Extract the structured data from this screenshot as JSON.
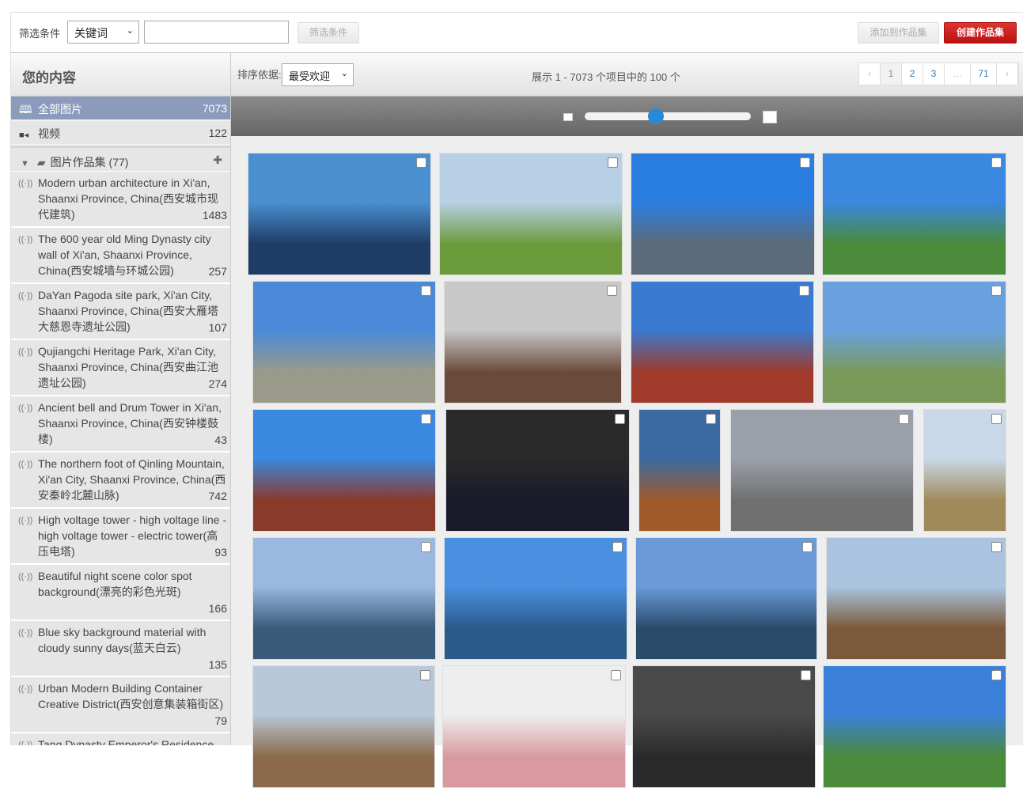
{
  "filter": {
    "label": "筛选条件",
    "field_value": "关键词",
    "input_value": "",
    "button": "筛选条件"
  },
  "actions": {
    "add": "添加到作品集",
    "create": "创建作品集"
  },
  "sidebar": {
    "title": "您的内容",
    "nav": [
      {
        "label": "全部图片",
        "count": "7073",
        "icon": "book-icon"
      },
      {
        "label": "视频",
        "count": "122",
        "icon": "video-icon"
      }
    ],
    "folder": {
      "label": "图片作品集 (77)",
      "toggle": "▼",
      "add": "✚"
    },
    "collections": [
      {
        "title": "Modern urban architecture in Xi'an, Shaanxi Province, China(西安城市现代建筑)",
        "count": "1483"
      },
      {
        "title": "The 600 year old Ming Dynasty city wall of Xi'an, Shaanxi Province, China(西安城墙与环城公园)",
        "count": "257"
      },
      {
        "title": "DaYan Pagoda site park, Xi'an City, Shaanxi Province, China(西安大雁塔大慈恩寺遗址公园)",
        "count": "107"
      },
      {
        "title": "Qujiangchi Heritage Park, Xi'an City, Shaanxi Province, China(西安曲江池遗址公园)",
        "count": "274"
      },
      {
        "title": "Ancient bell and Drum Tower in Xi'an, Shaanxi Province, China(西安钟楼鼓楼)",
        "count": "43"
      },
      {
        "title": "The northern foot of Qinling Mountain, Xi'an City, Shaanxi Province, China(西安秦岭北麓山脉)",
        "count": "742"
      },
      {
        "title": "High voltage tower - high voltage line - high voltage tower - electric tower(高压电塔)",
        "count": "93"
      },
      {
        "title": "Beautiful night scene color spot background(漂亮的彩色光斑)",
        "count": "166"
      },
      {
        "title": "Blue sky background material with cloudy sunny days(蓝天白云)",
        "count": "135"
      },
      {
        "title": "Urban Modern Building Container Creative District(西安创意集装箱街区)",
        "count": "79"
      },
      {
        "title": "Tang Dynasty Emperor's Residence, Daming Palace National Heritage Park, Xi'an, China(西安大明宫国家遗址",
        "count": ""
      }
    ]
  },
  "toolbar": {
    "sort_label": "排序依据:",
    "sort_value": "最受欢迎",
    "status": "展示 1 - 7073 个项目中的 100 个",
    "pages": [
      "‹",
      "1",
      "2",
      "3",
      "…",
      "71",
      "›"
    ]
  },
  "zoom_slider": {
    "value_percent": 43
  },
  "photos": [
    {
      "top": "#4a90d0",
      "bottom": "#1e3c66"
    },
    {
      "top": "#b8d0e6",
      "bottom": "#6a9a3a"
    },
    {
      "top": "#2a7ee0",
      "bottom": "#5a6a7a"
    },
    {
      "top": "#3a88e0",
      "bottom": "#4a8a3a"
    },
    {
      "top": "#4a8ad8",
      "bottom": "#9a9a8a"
    },
    {
      "top": "#c8c8c8",
      "bottom": "#6a4a3a"
    },
    {
      "top": "#3a7ad0",
      "bottom": "#a03a2a"
    },
    {
      "top": "#6aa0e0",
      "bottom": "#7a9a5a"
    },
    {
      "top": "#3a88e0",
      "bottom": "#8a3a2a"
    },
    {
      "top": "#2a2a2a",
      "bottom": "#1a1a2a"
    },
    {
      "top": "#3a6aa0",
      "bottom": "#a05a2a"
    },
    {
      "top": "#9aa0aa",
      "bottom": "#707070"
    },
    {
      "top": "#c8d8e8",
      "bottom": "#a08a5a"
    },
    {
      "top": "#9ab8e0",
      "bottom": "#3a5a7a"
    },
    {
      "top": "#4a90e0",
      "bottom": "#2a5a8a"
    },
    {
      "top": "#6a9ad8",
      "bottom": "#2a4a6a"
    },
    {
      "top": "#aac4e0",
      "bottom": "#7a5a3a"
    },
    {
      "top": "#b8c8d8",
      "bottom": "#8a6a4a"
    },
    {
      "top": "#eeeeee",
      "bottom": "#d89aa0"
    },
    {
      "top": "#4a4a4a",
      "bottom": "#2a2a2a"
    },
    {
      "top": "#3a80d8",
      "bottom": "#4a8a3a"
    }
  ]
}
